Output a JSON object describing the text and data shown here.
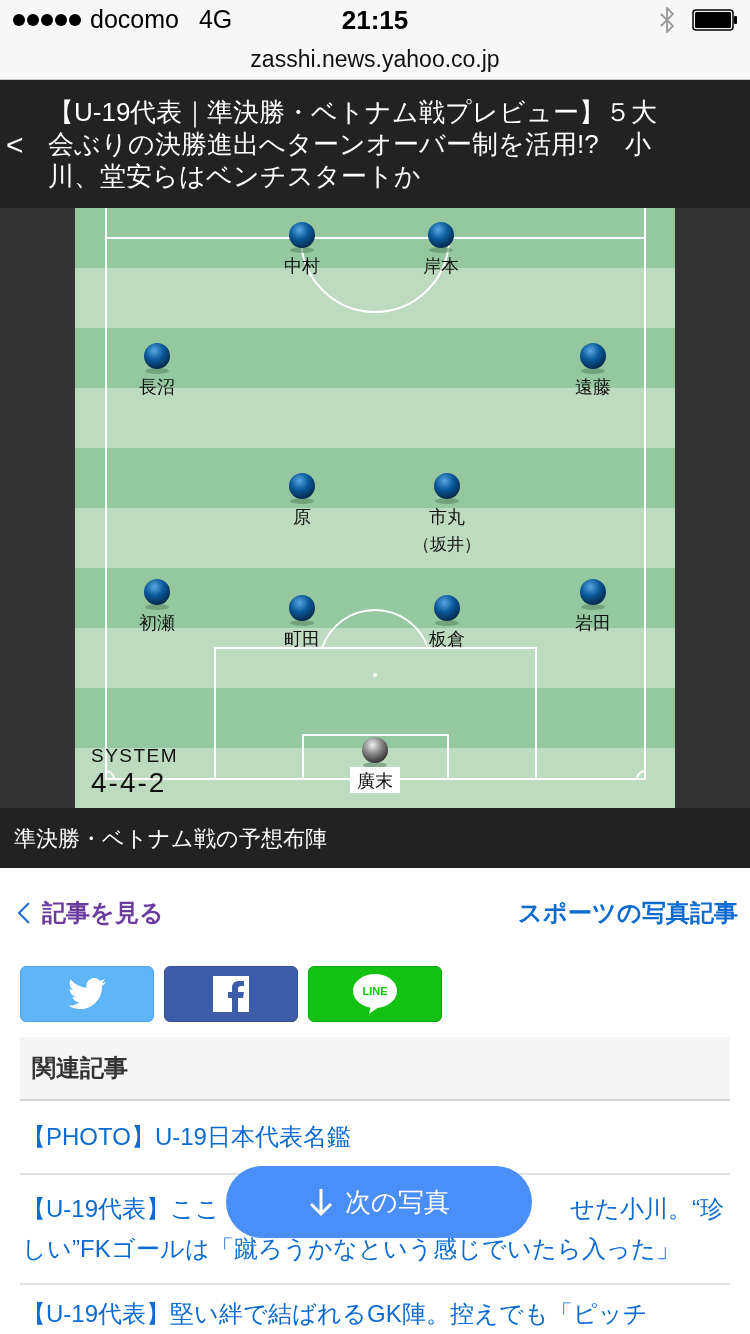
{
  "status_bar": {
    "carrier": "docomo",
    "network": "4G",
    "time": "21:15"
  },
  "url_bar": {
    "url": "zasshi.news.yahoo.co.jp"
  },
  "header": {
    "back": "<",
    "title_lines": [
      "【U-19代表｜準決勝・ベトナム戦プレビュー】５大",
      "会ぶりの決勝進出へターンオーバー制を活用!?　小",
      "川、堂安らはベンチスタートか"
    ]
  },
  "formation": {
    "system_label": "SYSTEM",
    "system": "4-4-2",
    "players": [
      {
        "name": "中村",
        "kind": "field"
      },
      {
        "name": "岸本",
        "kind": "field"
      },
      {
        "name": "長沼",
        "kind": "field"
      },
      {
        "name": "遠藤",
        "kind": "field"
      },
      {
        "name": "原",
        "kind": "field"
      },
      {
        "name": "市丸",
        "sub": "（坂井）",
        "kind": "field"
      },
      {
        "name": "初瀬",
        "kind": "field"
      },
      {
        "name": "町田",
        "kind": "field"
      },
      {
        "name": "板倉",
        "kind": "field"
      },
      {
        "name": "岩田",
        "kind": "field"
      },
      {
        "name": "廣末",
        "kind": "goalkeeper"
      }
    ]
  },
  "caption": "準決勝・ベトナム戦の予想布陣",
  "nav": {
    "back": "記事を見る",
    "category": "スポーツの写真記事"
  },
  "share_buttons": [
    {
      "kind": "twitter"
    },
    {
      "kind": "facebook"
    },
    {
      "kind": "line",
      "label": "LINE"
    }
  ],
  "related": {
    "title": "関連記事",
    "items": [
      "【PHOTO】U-19日本代表名鑑",
      {
        "left": "【U-19代表】ここ",
        "right": "せた小川。“珍",
        "rest": "しい”FKゴールは「蹴ろうかなという感じでいたら入った」"
      },
      "【U-19代表】堅い絆で結ばれるGK陣。控えでも「ピッチ"
    ]
  },
  "next_button": {
    "label": "次の写真"
  }
}
